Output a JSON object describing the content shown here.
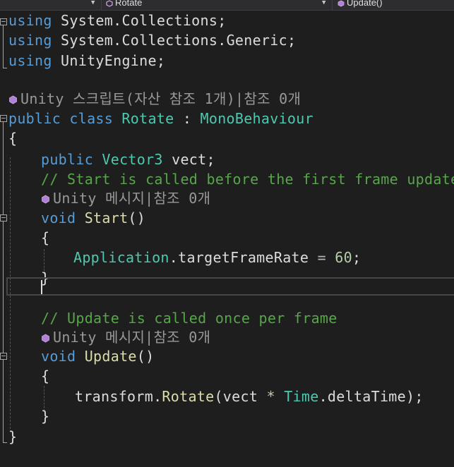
{
  "nav_bar": {
    "class_combo": "Rotate",
    "member_combo": "Update()"
  },
  "code_lines": {
    "l1": [
      "using",
      " System",
      ".",
      "Collections",
      ";"
    ],
    "l2": [
      "using",
      " System",
      ".",
      "Collections",
      ".",
      "Generic",
      ";"
    ],
    "l3": [
      "using",
      " UnityEngine",
      ";"
    ],
    "lens_class": "Unity 스크립트(자산 참조 1개)|참조 0개",
    "l5": [
      "public",
      " class",
      " Rotate",
      " : ",
      "MonoBehaviour"
    ],
    "l6": "{",
    "l7": [
      "public",
      " Vector3",
      " vect;"
    ],
    "l8": "// Start is called before the first frame update",
    "lens_start": "Unity 메시지|참조 0개",
    "l10": [
      "void",
      " Start",
      "()"
    ],
    "l11": "{",
    "l12": [
      "Application",
      ".targetFrameRate ",
      "=",
      " ",
      "60",
      ";"
    ],
    "l13": "}",
    "l15": "// Update is called once per frame",
    "lens_update": "Unity 메시지|참조 0개",
    "l17": [
      "void",
      " Update",
      "()"
    ],
    "l18": "{",
    "l19": [
      "transform",
      ".",
      "Rotate",
      "(vect ",
      "*",
      " ",
      "Time",
      ".deltaTime);"
    ],
    "l20": "}",
    "l21": "}"
  },
  "colors": {
    "keyword": "#569cd6",
    "type": "#4ec9b0",
    "method": "#dcdcaa",
    "comment": "#57a64a",
    "number": "#b5cea8",
    "lens": "#999999",
    "background": "#1e1e1e"
  }
}
